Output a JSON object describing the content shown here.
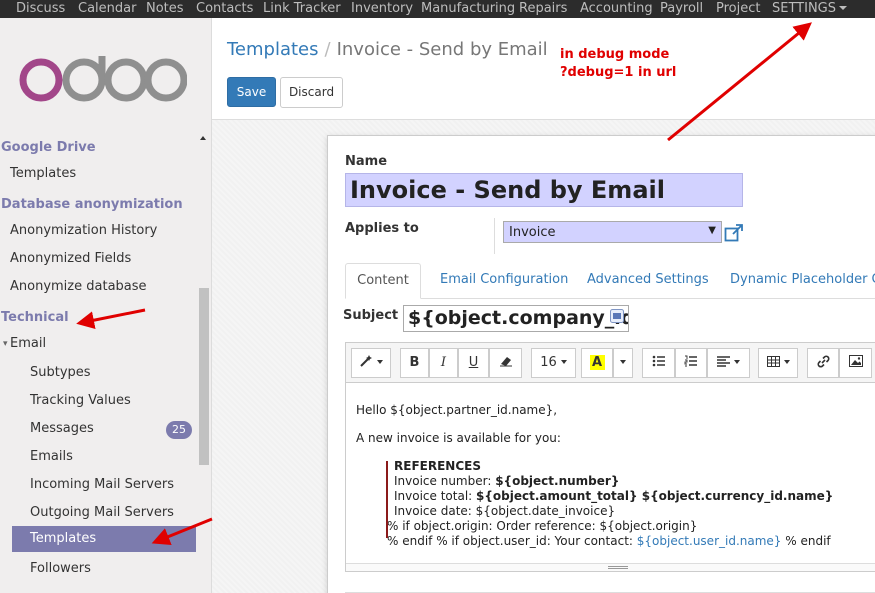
{
  "topbar": {
    "items": [
      "Discuss",
      "Calendar",
      "Notes",
      "Contacts",
      "Link Tracker",
      "Inventory",
      "Manufacturing",
      "Repairs",
      "Accounting",
      "Payroll",
      "Project",
      "SETTINGS"
    ]
  },
  "sidebar": {
    "logo": "odoo",
    "google_drive": {
      "title": "Google Drive",
      "items": [
        "Templates"
      ]
    },
    "db_anon": {
      "title": "Database anonymization",
      "items": [
        "Anonymization History",
        "Anonymized Fields",
        "Anonymize database"
      ]
    },
    "technical": {
      "title": "Technical",
      "email": "Email",
      "sub_items": [
        "Subtypes",
        "Tracking Values",
        "Messages",
        "Emails",
        "Incoming Mail Servers",
        "Outgoing Mail Servers",
        "Templates",
        "Followers"
      ],
      "messages_count": "25"
    }
  },
  "breadcrumb": {
    "parent": "Templates",
    "separator": "/",
    "current": "Invoice - Send by Email"
  },
  "buttons": {
    "save": "Save",
    "discard": "Discard"
  },
  "note": {
    "line1": "in debug mode",
    "line2": "?debug=1 in url",
    "color": "#e00000"
  },
  "form": {
    "name_label": "Name",
    "name_value": "Invoice - Send by Email",
    "applies_label": "Applies to",
    "applies_value": "Invoice",
    "tabs": [
      "Content",
      "Email Configuration",
      "Advanced Settings",
      "Dynamic Placeholder Gen"
    ],
    "subject_label": "Subject",
    "subject_value": "${object.company_id.n",
    "toolbar": {
      "font_size": "16",
      "bold": "B",
      "italic": "I",
      "underline": "U"
    },
    "body": {
      "line1": "Hello ${object.partner_id.name},",
      "line2": "A new invoice is available for you:",
      "ref_title": "REFERENCES",
      "inv_number_label": "Invoice number: ",
      "inv_number_value": "${object.number}",
      "inv_total_label": "Invoice total: ",
      "inv_total_value": "${object.amount_total} ${object.currency_id.name}",
      "inv_date": "Invoice date: ${object.date_invoice}",
      "origin": "% if object.origin:   Order reference: ${object.origin}",
      "contact_prefix": "% endif % if object.user_id:   Your contact: ",
      "contact_link": "${object.user_id.name}",
      "contact_suffix": " % endif"
    }
  },
  "colors": {
    "brand_purple": "#7c7bad",
    "primary_blue": "#337ab7",
    "field_highlight": "#d2d2ff",
    "annotation_red": "#e00000"
  }
}
